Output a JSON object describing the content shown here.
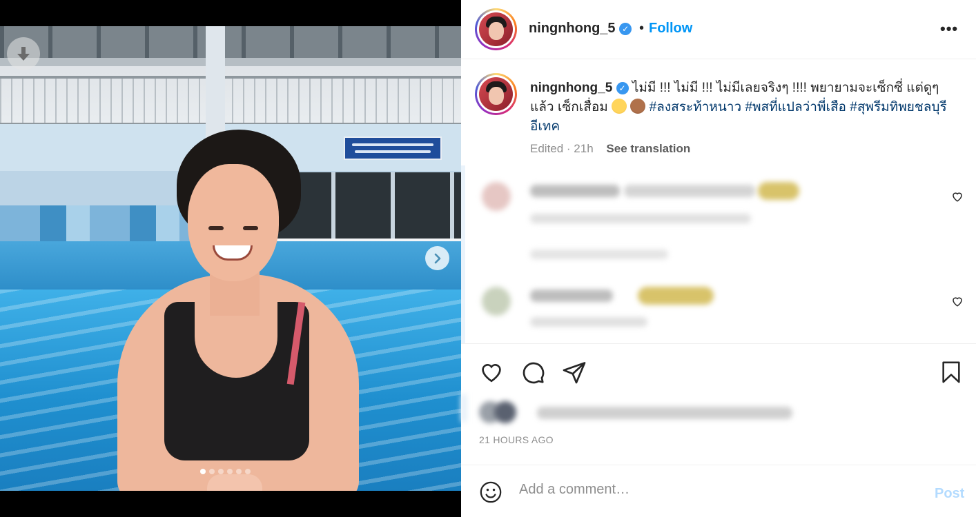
{
  "post": {
    "username": "ningnhong_5",
    "verified_glyph": "✓",
    "separator": "•",
    "follow_label": "Follow",
    "more_label": "•••"
  },
  "caption": {
    "username": "ningnhong_5",
    "text_before_emoji": "ไม่มี !!! ไม่มี !!! ไม่มีเลยจริงๆ !!!! พยายามจะเซ็กซี่ แต่ดูๆแล้ว เซ็กเสื่อม",
    "emojis": [
      "grinning-sweat-emoji",
      "see-no-evil-monkey-emoji"
    ],
    "hashtags": [
      "#ลงสระท้าหนาว",
      "#พสที่แปลว่าพี่เสือ",
      "#สุพรีมทิพยชลบุรีอีเทค"
    ],
    "edited": "Edited · 21h",
    "see_translation": "See translation"
  },
  "comments_blurred": [
    {
      "has_like_icon": true
    },
    {
      "has_like_icon": true
    }
  ],
  "time_ago": "21 HOURS AGO",
  "composer": {
    "placeholder": "Add a comment…",
    "post_label": "Post"
  },
  "carousel": {
    "total_slides": 6,
    "active_slide": 1
  },
  "icons": [
    "download-icon",
    "chevron-right-icon",
    "like-icon",
    "comment-icon",
    "share-icon",
    "save-icon",
    "emoji-icon",
    "more-icon"
  ],
  "colors": {
    "link_blue": "#0095f6",
    "hashtag": "#00376b",
    "post_disabled": "#b3dbff",
    "verified": "#3897f0"
  }
}
